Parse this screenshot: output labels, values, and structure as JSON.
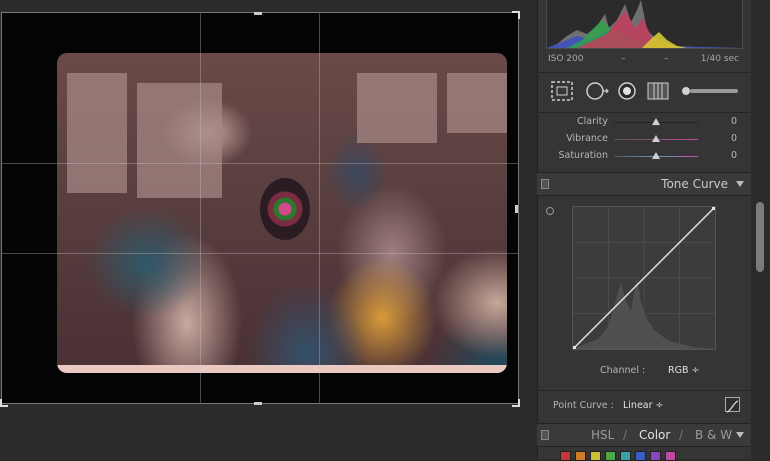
{
  "exif": {
    "iso": "ISO 200",
    "dash1": "–",
    "dash2": "–",
    "shutter": "1/40 sec"
  },
  "presence": {
    "sliders": [
      {
        "label": "Clarity",
        "value": "0",
        "level": 0.5
      },
      {
        "label": "Vibrance",
        "value": "0",
        "level": 0.5
      },
      {
        "label": "Saturation",
        "value": "0",
        "level": 0.5
      }
    ]
  },
  "tone_curve": {
    "title": "Tone Curve",
    "channel_label": "Channel :",
    "channel_value": "RGB ÷",
    "point_curve_label": "Point Curve :",
    "point_curve_value": "Linear ÷"
  },
  "hsl": {
    "tabs": [
      "HSL",
      "Color",
      "B & W"
    ],
    "separator": "/",
    "active_tab": "Color",
    "swatch_colors": [
      "#c43838",
      "#d07a2a",
      "#c9c236",
      "#4aa84a",
      "#3aa0a0",
      "#3b5ec4",
      "#8a45c0",
      "#c04aa0"
    ]
  },
  "colors": {
    "panel_bg": "#353535",
    "canvas_bg": "#2c2c2c",
    "text": "#bdbdbd"
  },
  "icons": [
    "crop-overlay-icon",
    "spot-removal-icon",
    "red-eye-icon",
    "graduated-filter-icon",
    "adjustment-brush-icon",
    "target-adjustment-icon",
    "point-curve-icon",
    "panel-switch-icon",
    "collapse-triangle-icon"
  ]
}
